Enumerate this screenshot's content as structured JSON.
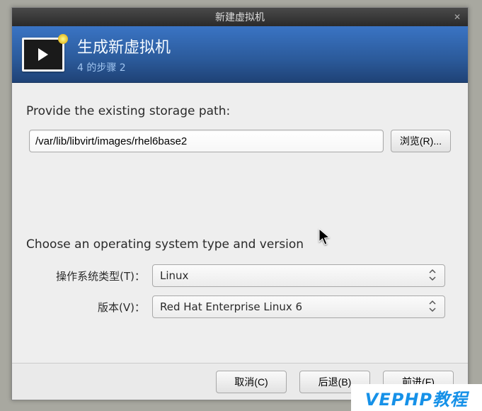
{
  "window": {
    "title": "新建虚拟机",
    "close_glyph": "✕"
  },
  "banner": {
    "title": "生成新虚拟机",
    "step": "4 的步骤 2"
  },
  "storage": {
    "heading": "Provide the existing storage path:",
    "path_value": "/var/lib/libvirt/images/rhel6base2",
    "browse_label": "浏览(R)..."
  },
  "os": {
    "heading": "Choose an operating system type and version",
    "type_label": "操作系统类型(T)：",
    "type_value": "Linux",
    "version_label": "版本(V)：",
    "version_value": "Red Hat Enterprise Linux 6"
  },
  "actions": {
    "cancel": "取消(C)",
    "back": "后退(B)",
    "forward": "前进(F)"
  },
  "watermark": "VEPHP教程"
}
